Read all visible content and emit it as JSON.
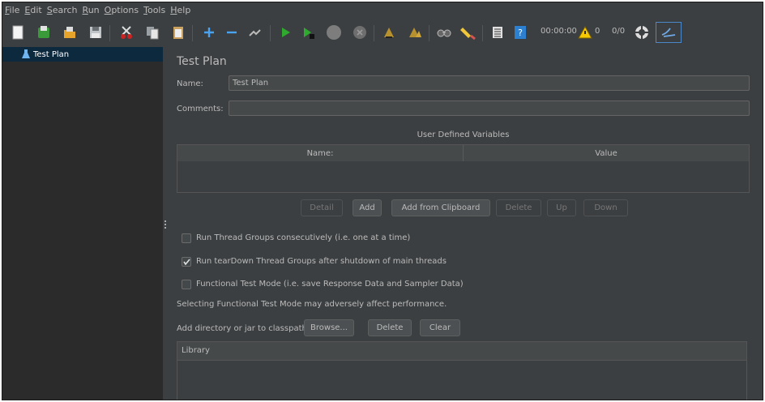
{
  "menubar": [
    {
      "mnemonic": "F",
      "rest": "ile"
    },
    {
      "mnemonic": "E",
      "rest": "dit"
    },
    {
      "mnemonic": "S",
      "rest": "earch"
    },
    {
      "mnemonic": "R",
      "rest": "un"
    },
    {
      "mnemonic": "O",
      "rest": "ptions"
    },
    {
      "mnemonic": "T",
      "rest": "ools"
    },
    {
      "mnemonic": "H",
      "rest": "elp"
    }
  ],
  "toolbar": {
    "icons": [
      "new-icon",
      "templates-icon",
      "open-icon",
      "save-icon",
      "cut-icon",
      "copy-icon",
      "paste-icon",
      "expand-icon",
      "collapse-icon",
      "toggle-icon",
      "start-icon",
      "start-no-pauses-icon",
      "stop-icon",
      "shutdown-icon",
      "clear-icon",
      "clear-all-icon",
      "search-icon",
      "reset-search-icon",
      "function-helper-icon",
      "help-icon",
      "warning-icon",
      "remote-icon",
      "logo-icon"
    ],
    "elapsed_time": "00:00:00",
    "warning_count": "0",
    "thread_count": "0/0"
  },
  "tree": {
    "items": [
      {
        "label": "Test Plan",
        "icon": "flask-icon"
      }
    ]
  },
  "panel": {
    "title": "Test Plan",
    "name_label": "Name:",
    "name_value": "Test Plan",
    "comments_label": "Comments:",
    "comments_value": "",
    "udv_title": "User Defined Variables",
    "udv_columns": [
      "Name:",
      "Value"
    ],
    "udv_buttons": [
      {
        "label": "Detail",
        "enabled": false
      },
      {
        "label": "Add",
        "enabled": true
      },
      {
        "label": "Add from Clipboard",
        "enabled": true
      },
      {
        "label": "Delete",
        "enabled": false
      },
      {
        "label": "Up",
        "enabled": false
      },
      {
        "label": "Down",
        "enabled": false
      }
    ],
    "options": [
      {
        "label": "Run Thread Groups consecutively (i.e. one at a time)",
        "checked": false
      },
      {
        "label": "Run tearDown Thread Groups after shutdown of main threads",
        "checked": true
      },
      {
        "label": "Functional Test Mode (i.e. save Response Data and Sampler Data)",
        "checked": false
      }
    ],
    "functional_note": "Selecting Functional Test Mode may adversely affect performance.",
    "classpath_label": "Add directory or jar to classpath",
    "classpath_buttons": [
      "Browse...",
      "Delete",
      "Clear"
    ],
    "library_header": "Library"
  },
  "colors": {
    "background": "#3c3f41",
    "tree_bg": "#2b2b2b",
    "selected": "#0d293e",
    "text": "#bbbbbb"
  }
}
